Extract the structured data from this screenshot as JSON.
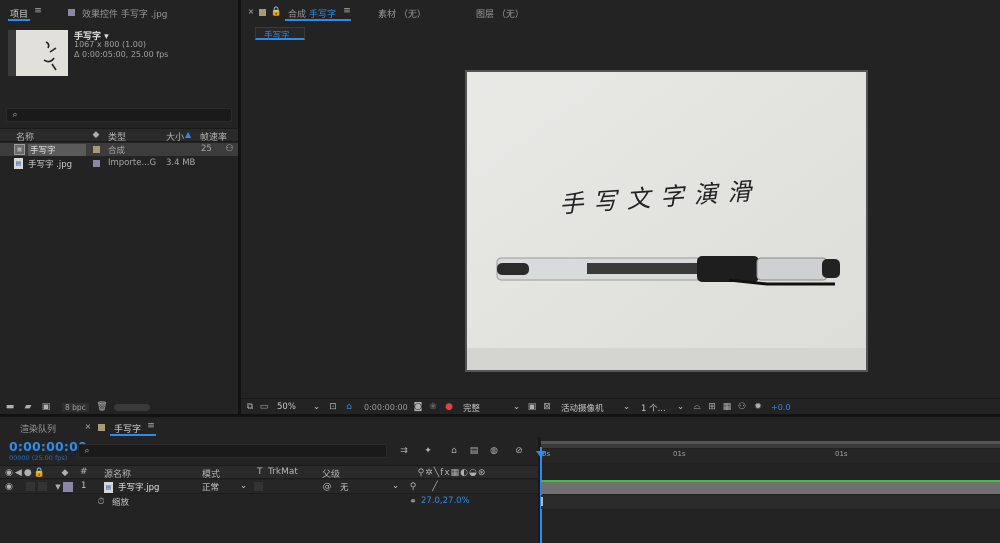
{
  "project_panel": {
    "tab_project": "项目",
    "tab_effects": "效果控件 手写字 .jpg",
    "item_name": "手写字 ▾",
    "item_dims": "1067 x 800 (1.00)",
    "item_duration": "Δ 0:00:05:00, 25.00 fps",
    "columns": {
      "name": "名称",
      "type": "类型",
      "size": "大小",
      "framerate": "帧速率"
    },
    "rows": [
      {
        "name": "手写字",
        "type": "合成",
        "size": "",
        "framerate": "25",
        "color": "#a89a74"
      },
      {
        "name": "手写字 .jpg",
        "type": "Importe...G",
        "size": "3.4 MB",
        "framerate": "",
        "color": "#8c87a8"
      }
    ],
    "bpc": "8 bpc"
  },
  "viewer": {
    "tab_comp_prefix": "合成",
    "tab_comp_name": "手写字",
    "tab_footage": "素材 （无）",
    "tab_layer": "图层 （无）",
    "breadcrumb": "手写字",
    "footer": {
      "zoom": "50%",
      "timecode": "0:00:00:00",
      "quality": "完整",
      "camera": "活动摄像机",
      "views": "1 个...",
      "exposure": "+0.0"
    }
  },
  "timeline": {
    "tab_render": "渲染队列",
    "tab_comp": "手写字",
    "timecode": "0:00:00:00",
    "frame_info": "00000 (25.00 fps)",
    "columns": {
      "index": "#",
      "source": "源名称",
      "mode": "模式",
      "t": "T",
      "trkmat": "TrkMat",
      "parent": "父级"
    },
    "layer": {
      "index": "1",
      "name": "手写字.jpg",
      "mode": "正常",
      "parent": "无"
    },
    "property": {
      "name": "缩放",
      "value": "27.0,27.0%"
    },
    "ruler": [
      "0s",
      "01s",
      "01s"
    ]
  },
  "canvas": {
    "text": "手 写 文 字 演 滑"
  }
}
